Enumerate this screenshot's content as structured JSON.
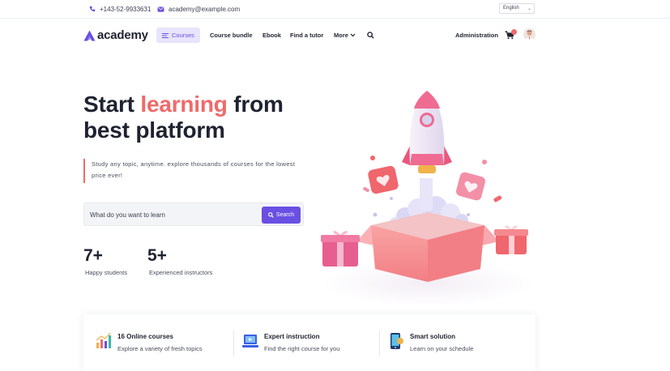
{
  "topbar": {
    "phone": "+143-52-9933631",
    "email": "academy@example.com",
    "language": "English"
  },
  "nav": {
    "logo_text": "academy",
    "items": [
      {
        "label": "Courses"
      },
      {
        "label": "Course bundle"
      },
      {
        "label": "Ebook"
      },
      {
        "label": "Find a tutor"
      },
      {
        "label": "More"
      }
    ],
    "admin_label": "Administration",
    "cart_count": "0"
  },
  "hero": {
    "title_start": "Start ",
    "title_highlight": "learning",
    "title_end": " from best platform",
    "description": "Study any topic, anytime. explore thousands of courses for the lowest price ever!",
    "search_placeholder": "What do you want to learn",
    "search_button": "Search",
    "stats": [
      {
        "value": "7+",
        "label": "Happy students"
      },
      {
        "value": "5+",
        "label": "Experienced instructors"
      }
    ]
  },
  "features": [
    {
      "title": "16 Online courses",
      "desc": "Explore a variety of fresh topics",
      "icon": "bar-chart-icon"
    },
    {
      "title": "Expert instruction",
      "desc": "Find the right course for you",
      "icon": "video-laptop-icon"
    },
    {
      "title": "Smart solution",
      "desc": "Learn on your schedule",
      "icon": "mobile-phone-icon"
    }
  ],
  "colors": {
    "accent": "#6a4fe3",
    "highlight": "#f06a6a",
    "text": "#1f2230"
  }
}
